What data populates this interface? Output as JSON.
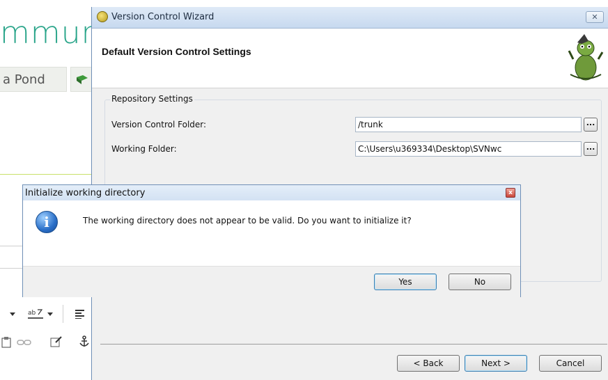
{
  "background": {
    "heading_fragment": "mmur",
    "tab_fragment": "a Pond"
  },
  "wizard": {
    "title": "Version Control Wizard",
    "close_symbol": "✕",
    "heading": "Default Version Control Settings",
    "group_title": "Repository Settings",
    "rows": [
      {
        "label": "Version Control Folder:",
        "value": "/trunk",
        "button": "..."
      },
      {
        "label": "Working Folder:",
        "value": "C:\\Users\\u369334\\Desktop\\SVNwc",
        "button": "..."
      }
    ],
    "buttons": {
      "back": "< Back",
      "next": "Next >",
      "cancel": "Cancel"
    }
  },
  "dialog": {
    "title": "Initialize working directory",
    "close_symbol": "x",
    "icon": "info-icon",
    "icon_glyph": "i",
    "message": "The working directory does not appear to be valid. Do you want to initialize it?",
    "buttons": {
      "yes": "Yes",
      "no": "No"
    }
  },
  "colors": {
    "brand_green": "#2aa58a",
    "titlebar": "#c7d9ef",
    "dialog_background": "#f0f0f0"
  }
}
